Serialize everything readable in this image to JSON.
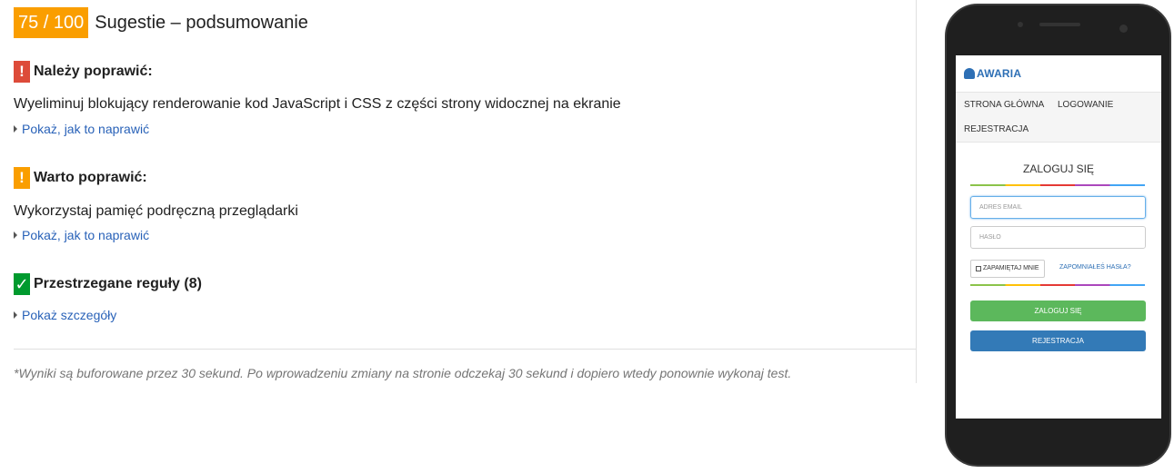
{
  "summary": {
    "score": "75 / 100",
    "title": "Sugestie – podsumowanie"
  },
  "sections": {
    "should_fix": {
      "icon": "exclamation-icon",
      "title": "Należy poprawić:",
      "rule": "Wyeliminuj blokujący renderowanie kod JavaScript i CSS z części strony widocznej na ekranie",
      "link": "Pokaż, jak to naprawić",
      "color": "#dd4b39"
    },
    "consider_fixing": {
      "icon": "exclamation-icon",
      "title": "Warto poprawić:",
      "rule": "Wykorzystaj pamięć podręczną przeglądarki",
      "link": "Pokaż, jak to naprawić",
      "color": "#fa9e00"
    },
    "passed": {
      "icon": "checkmark-icon",
      "title": "Przestrzegane reguły (8)",
      "link": "Pokaż szczegóły",
      "color": "#009a2e"
    }
  },
  "footnote": "*Wyniki są buforowane przez 30 sekund. Po wprowadzeniu zmiany na stronie odczekaj 30 sekund i dopiero wtedy ponownie wykonaj test.",
  "icons": {
    "exclamation": "!",
    "check": "✓"
  },
  "preview": {
    "logo": "AWARIA",
    "nav": [
      "STRONA GŁÓWNA",
      "LOGOWANIE",
      "REJESTRACJA"
    ],
    "form_title": "ZALOGUJ SIĘ",
    "email_placeholder": "ADRES EMAIL",
    "password_placeholder": "HASŁO",
    "remember_label": "ZAPAMIĘTAJ MNIE",
    "forgot_link": "ZAPOMNIAŁEŚ HASŁA?",
    "login_button": "ZALOGUJ SIĘ",
    "register_button": "REJESTRACJA"
  }
}
